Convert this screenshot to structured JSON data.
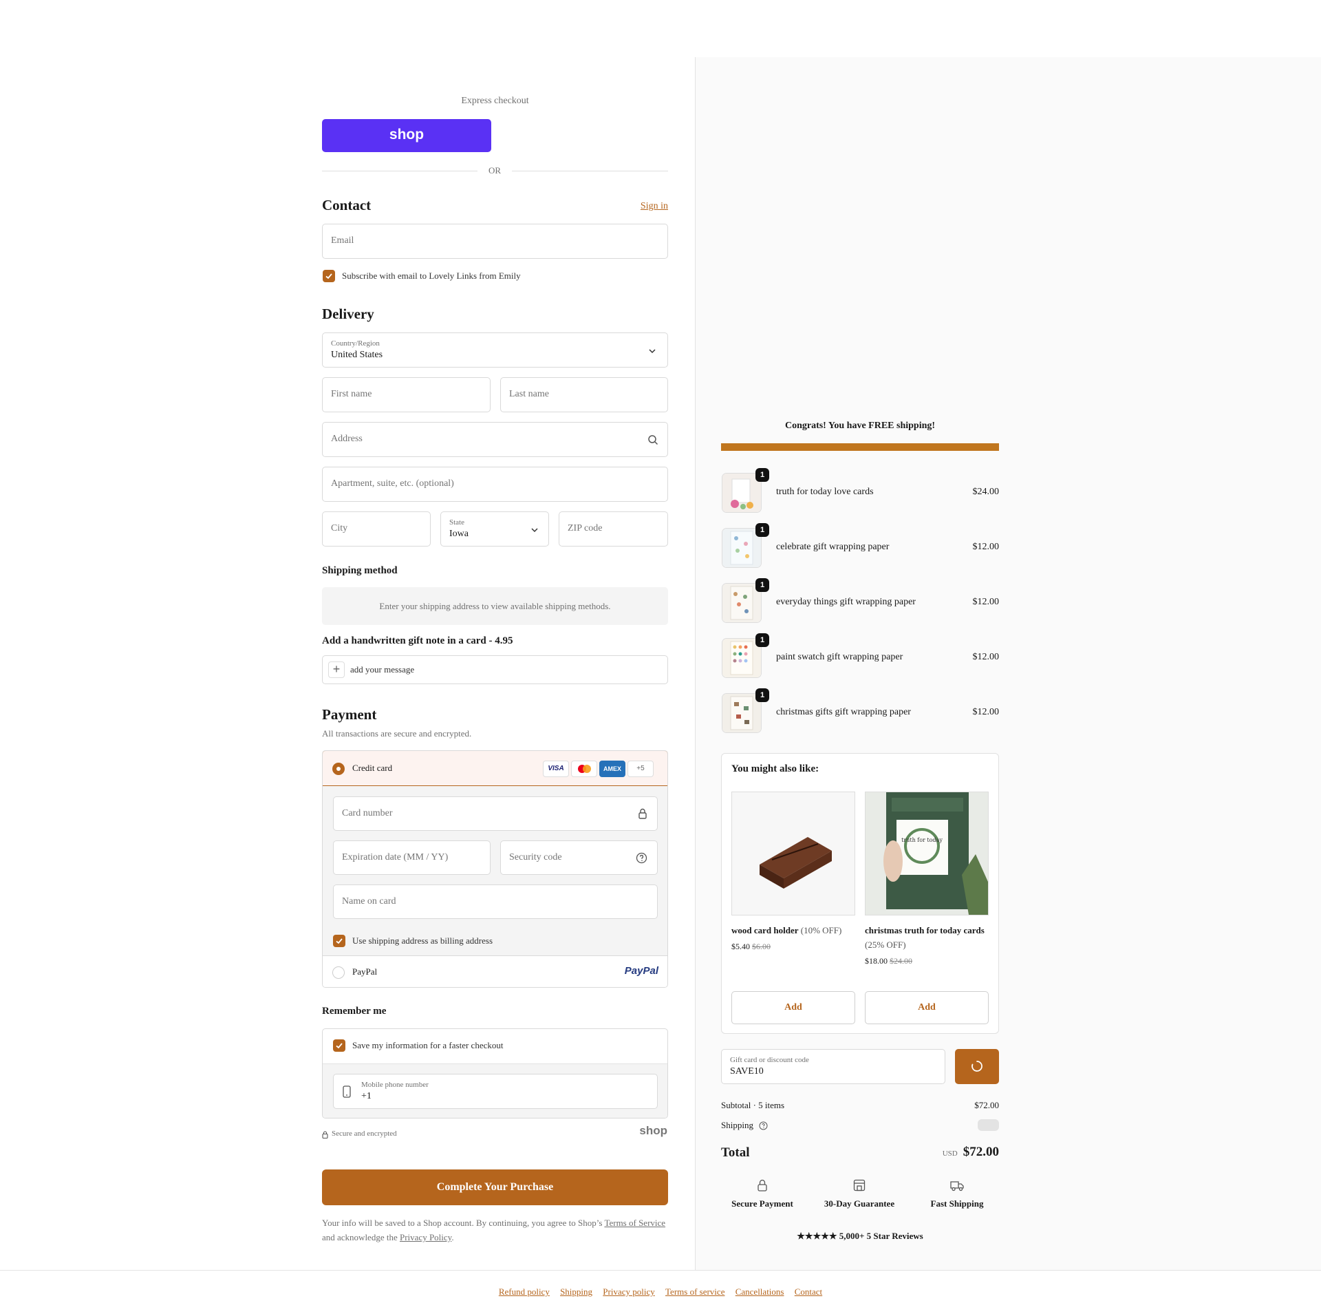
{
  "express": {
    "label": "Express checkout",
    "shop_button": "shop",
    "or": "OR"
  },
  "contact": {
    "title": "Contact",
    "sign_in": "Sign in",
    "email_placeholder": "Email",
    "subscribe_label": "Subscribe with email to Lovely Links from Emily"
  },
  "delivery": {
    "title": "Delivery",
    "country_label": "Country/Region",
    "country_value": "United States",
    "first_name": "First name",
    "last_name": "Last name",
    "address": "Address",
    "apartment": "Apartment, suite, etc. (optional)",
    "city": "City",
    "state_label": "State",
    "state_value": "Iowa",
    "zip": "ZIP code"
  },
  "shipping_method": {
    "title": "Shipping method",
    "message": "Enter your shipping address to view available shipping methods."
  },
  "gift_note": {
    "title": "Add a handwritten gift note in a card - 4.95",
    "add_label": "add your message"
  },
  "payment": {
    "title": "Payment",
    "subtitle": "All transactions are secure and encrypted.",
    "credit_card_label": "Credit card",
    "card_brands": [
      "VISA",
      "",
      "AMEX",
      "+5"
    ],
    "card_number": "Card number",
    "expiration": "Expiration date (MM / YY)",
    "security_code": "Security code",
    "name_on_card": "Name on card",
    "billing_same": "Use shipping address as billing address",
    "paypal_label": "PayPal",
    "paypal_logo": "PayPal"
  },
  "remember": {
    "title": "Remember me",
    "save_label": "Save my information for a faster checkout",
    "phone_label": "Mobile phone number",
    "phone_value": "+1",
    "secure_text": "Secure and encrypted",
    "shop_logo": "shop"
  },
  "purchase_button": "Complete Your Purchase",
  "legal": {
    "line1": "Your info will be saved to a Shop account. By continuing, you agree to Shop’s",
    "terms": "Terms of Service",
    "line2": "and acknowledge the",
    "privacy": "Privacy Policy",
    "end": "."
  },
  "cart": {
    "free_shipping_message": "Congrats! You have FREE shipping!",
    "free_shipping_progress": 1.0,
    "items": [
      {
        "name": "truth for today love cards",
        "price": "$24.00",
        "qty": "1"
      },
      {
        "name": "celebrate gift wrapping paper",
        "price": "$12.00",
        "qty": "1"
      },
      {
        "name": "everyday things gift wrapping paper",
        "price": "$12.00",
        "qty": "1"
      },
      {
        "name": "paint swatch gift wrapping paper",
        "price": "$12.00",
        "qty": "1"
      },
      {
        "name": "christmas gifts gift wrapping paper",
        "price": "$12.00",
        "qty": "1"
      }
    ]
  },
  "upsell": {
    "title": "You might also like:",
    "products": [
      {
        "name": "wood card holder",
        "discount": "(10% OFF)",
        "price": "$5.40",
        "old_price": "$6.00",
        "button": "Add"
      },
      {
        "name": "christmas truth for today cards",
        "discount": "(25% OFF)",
        "price": "$18.00",
        "old_price": "$24.00",
        "button": "Add",
        "image_text": "truth for today"
      }
    ]
  },
  "discount": {
    "label": "Gift card or discount code",
    "value": "SAVE10"
  },
  "summary": {
    "subtotal_label": "Subtotal · 5 items",
    "subtotal_value": "$72.00",
    "shipping_label": "Shipping",
    "total_label": "Total",
    "currency": "USD",
    "total_value": "$72.00"
  },
  "trust": [
    {
      "label": "Secure Payment",
      "icon": "lock-icon"
    },
    {
      "label": "30-Day Guarantee",
      "icon": "store-icon"
    },
    {
      "label": "Fast Shipping",
      "icon": "truck-icon"
    }
  ],
  "reviews": "★★★★★ 5,000+ 5 Star Reviews",
  "footer_links": [
    "Refund policy",
    "Shipping",
    "Privacy policy",
    "Terms of service",
    "Cancellations",
    "Contact"
  ],
  "colors": {
    "accent": "#b5651d",
    "shop_purple": "#5a31f4",
    "right_bg": "#fafafa"
  }
}
